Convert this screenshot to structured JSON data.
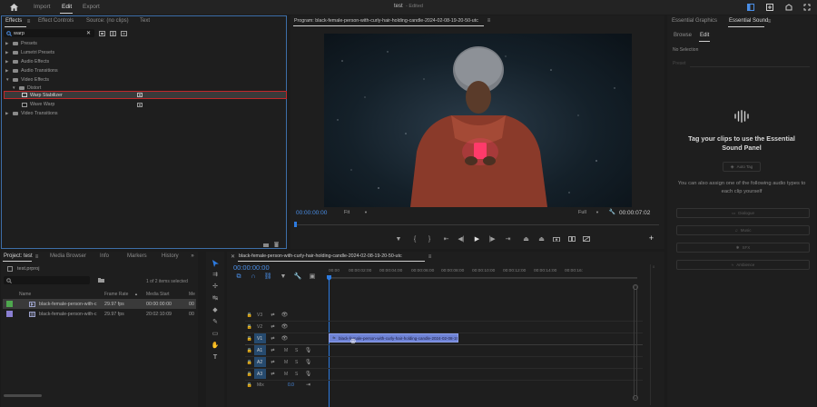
{
  "topbar": {
    "menus": [
      "Import",
      "Edit",
      "Export"
    ],
    "active_menu": "Edit",
    "project_title": "test",
    "edited_label": "- Edited"
  },
  "effects_panel": {
    "tabs": [
      "Effects",
      "Effect Controls",
      "Source: (no clips)",
      "Text"
    ],
    "search_value": "warp",
    "tree": [
      {
        "label": "Presets",
        "level": 0,
        "kind": "folder"
      },
      {
        "label": "Lumetri Presets",
        "level": 0,
        "kind": "folder"
      },
      {
        "label": "Audio Effects",
        "level": 0,
        "kind": "folder"
      },
      {
        "label": "Audio Transitions",
        "level": 0,
        "kind": "folder"
      },
      {
        "label": "Video Effects",
        "level": 0,
        "kind": "folder",
        "expanded": true
      },
      {
        "label": "Distort",
        "level": 1,
        "kind": "folder",
        "expanded": true
      },
      {
        "label": "Warp Stabilizer",
        "level": 2,
        "kind": "effect",
        "selected": true
      },
      {
        "label": "Wave Warp",
        "level": 2,
        "kind": "effect"
      },
      {
        "label": "Video Transitions",
        "level": 0,
        "kind": "folder"
      }
    ]
  },
  "program_monitor": {
    "title": "Program: black-female-person-with-curly-hair-holding-candle-2024-02-08-19-20-50-utc",
    "timecode_current": "00:00:00:00",
    "fit": "Fit",
    "quality": "Full",
    "timecode_duration": "00:00:07:02"
  },
  "essential_sound": {
    "tabs": [
      "Essential Graphics",
      "Essential Sound"
    ],
    "subtabs": [
      "Browse",
      "Edit"
    ],
    "no_selection": "No Selection",
    "preset_label": "Preset",
    "tag_title": "Tag your clips to use the Essential Sound Panel",
    "auto_tag": "Auto Tag",
    "assign_text": "You can also assign one of the following audio types to each clip yourself",
    "types": [
      "Dialogue",
      "Music",
      "SFX",
      "Ambience"
    ]
  },
  "project_panel": {
    "tabs": [
      "Project: test",
      "Media Browser",
      "Info",
      "Markers",
      "History"
    ],
    "project_file": "test.prproj",
    "items_count": "1 of 2 items selected",
    "columns": [
      "Name",
      "Frame Rate",
      "Media Start",
      "Me"
    ],
    "rows": [
      {
        "name": "black-female-person-with-c",
        "fps": "29.97 fps",
        "start": "00:00:00:00",
        "extra": "00",
        "color": "#4ea84e",
        "selected": true
      },
      {
        "name": "black-female-person-with-c",
        "fps": "29.97 fps",
        "start": "20:02:10:09",
        "extra": "00",
        "color": "#8a7fd1",
        "selected": false
      }
    ]
  },
  "timeline": {
    "sequence_name": "black-female-person-with-curly-hair-holding-candle-2024-02-08-19-20-50-utc",
    "timecode": "00:00:00:00",
    "ruler": [
      "00:00",
      "00:00:02:00",
      "00:00:04:00",
      "00:00:06:00",
      "00:00:08:00",
      "00:00:10:00",
      "00:00:12:00",
      "00:00:14:00",
      "00:00:16:"
    ],
    "video_tracks": [
      "V3",
      "V2",
      "V1"
    ],
    "audio_tracks": [
      "A1",
      "A2",
      "A3"
    ],
    "mix_label": "Mix",
    "mix_value": "0.0",
    "clip_label": "black-female-person-with-curly-hair-holding-candle-2024-02-08-19-20-50-utc"
  },
  "colors": {
    "accent_blue": "#2d7be0",
    "clip_blue": "#6f83d6",
    "selection_red": "#c0282a"
  }
}
